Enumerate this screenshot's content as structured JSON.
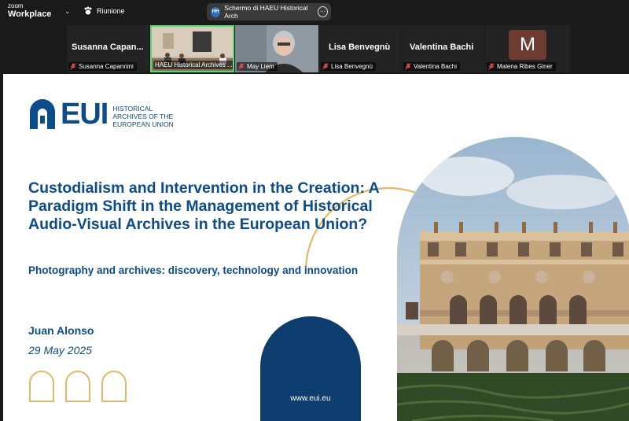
{
  "app": {
    "name_line1": "zoom",
    "name_line2": "Workplace"
  },
  "meeting": {
    "name": "Riunione"
  },
  "share": {
    "label": "Schermo di HAEU Historical Arch",
    "icon_text": "HH"
  },
  "participants": [
    {
      "display": "Susanna Capan...",
      "label": "Susanna Capannini",
      "muted": true
    },
    {
      "display": "",
      "label": "HAEU Historical Archives ...",
      "muted": false,
      "active": true
    },
    {
      "display": "",
      "label": "May Liem",
      "muted": true
    },
    {
      "display": "Lisa Benvegnù",
      "label": "Lisa Benvegnù",
      "muted": true
    },
    {
      "display": "Valentina Bachi",
      "label": "Valentina Bachi",
      "muted": true
    },
    {
      "display": "M",
      "label": "Malena Ribes Giner",
      "muted": true
    }
  ],
  "slide": {
    "logo_text": "EUI",
    "logo_sub": [
      "HISTORICAL",
      "ARCHIVES OF THE",
      "EUROPEAN UNION"
    ],
    "title": "Custodialism and Intervention in the Creation: A Paradigm Shift in the Management of Historical Audio-Visual Archives in the European Union?",
    "subtitle": "Photography and archives: discovery, technology and innovation",
    "author": "Juan Alonso",
    "date": "29 May 2025",
    "url": "www.eui.eu",
    "colors": {
      "navy": "#0d4c8b",
      "gold": "#e3b866",
      "dark_arch": "#0e3e6f"
    }
  }
}
